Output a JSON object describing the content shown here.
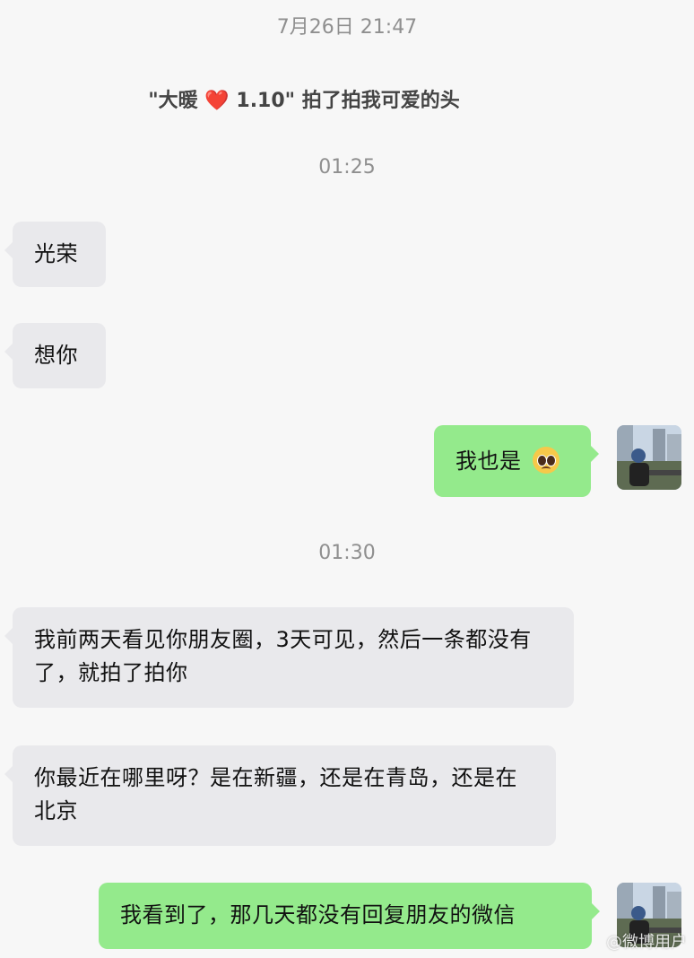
{
  "timestamps": [
    "7月26日 21:47",
    "01:25",
    "01:30"
  ],
  "system_notice": {
    "prefix": "\"大暖 ",
    "heart": "❤️",
    "suffix": " 1.10\" 拍了拍我可爱的头"
  },
  "messages": [
    {
      "from": "other",
      "text": "光荣"
    },
    {
      "from": "other",
      "text": "想你"
    },
    {
      "from": "me",
      "text": "我也是 ",
      "emoji": "pleading-face-emoji"
    },
    {
      "from": "other",
      "text": "我前两天看见你朋友圈，3天可见，然后一条都没有了，就拍了拍你"
    },
    {
      "from": "other",
      "text": "你最近在哪里呀？是在新疆，还是在青岛，还是在北京"
    },
    {
      "from": "me",
      "text": "我看到了，那几天都没有回复朋友的微信"
    }
  ],
  "watermark": "@微博用户",
  "colors": {
    "background": "#f7f7f7",
    "incoming_bubble": "#e9e9ec",
    "outgoing_bubble": "#94ea8c",
    "timestamp_text": "#8f8f8f"
  }
}
